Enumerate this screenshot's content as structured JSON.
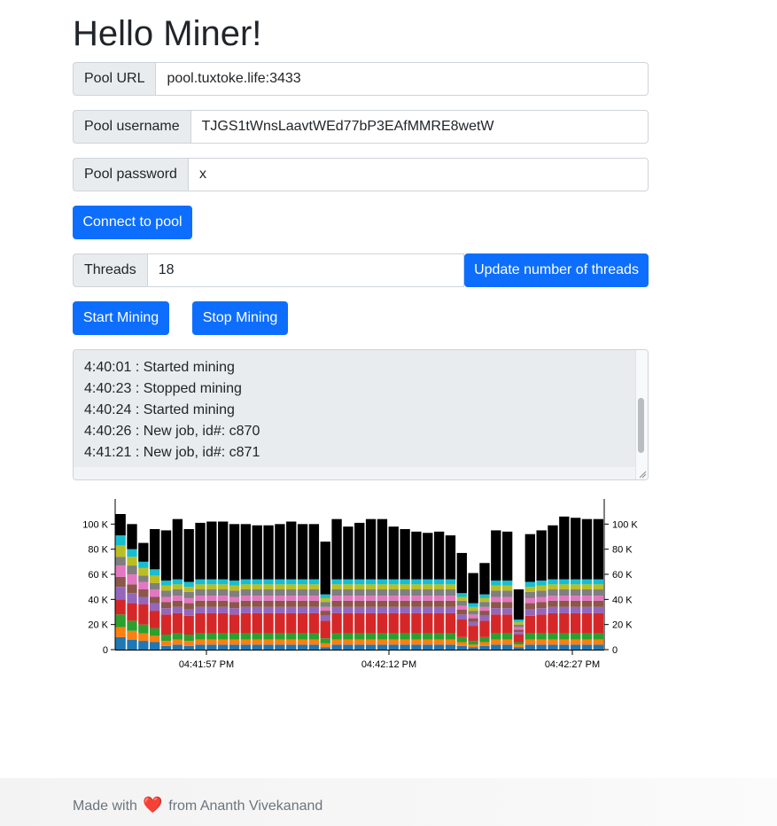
{
  "header": {
    "title": "Hello Miner!"
  },
  "pool": {
    "url_label": "Pool URL",
    "url_value": "pool.tuxtoke.life:3433",
    "username_label": "Pool username",
    "username_value": "TJGS1tWnsLaavtWEd77bP3EAfMMRE8wetW",
    "password_label": "Pool password",
    "password_value": "x",
    "connect_label": "Connect to pool"
  },
  "threads": {
    "label": "Threads",
    "value": "18",
    "update_label": "Update number of threads"
  },
  "mining": {
    "start_label": "Start Mining",
    "stop_label": "Stop Mining"
  },
  "log": {
    "lines": [
      "4:40:01 : Started mining",
      "4:40:23 : Stopped mining",
      "4:40:24 : Started mining",
      "4:40:26 : New job, id#: c870",
      "4:41:21 : New job, id#: c871"
    ]
  },
  "chart_data": {
    "type": "bar",
    "stacked": true,
    "y_ticks": [
      "0",
      "20 K",
      "40 K",
      "60 K",
      "80 K",
      "100 K"
    ],
    "ylim": [
      0,
      120000
    ],
    "x_ticks": [
      "04:41:57 PM",
      "04:42:12 PM",
      "04:42:27 PM"
    ],
    "series_colors": [
      "#1f77b4",
      "#ff7f0e",
      "#2ca02c",
      "#d62728",
      "#9467bd",
      "#8c564b",
      "#e377c2",
      "#7f7f7f",
      "#bcbd22",
      "#17becf",
      "#000000"
    ],
    "bars": [
      [
        10000,
        8000,
        10000,
        12000,
        10000,
        8000,
        9000,
        7000,
        9000,
        8000,
        17000
      ],
      [
        8000,
        7000,
        8000,
        14000,
        8000,
        7000,
        8000,
        7000,
        7000,
        6000,
        20000
      ],
      [
        7000,
        6000,
        7000,
        16000,
        6000,
        6000,
        6000,
        5000,
        6000,
        5000,
        15000
      ],
      [
        6000,
        5000,
        6000,
        14000,
        6000,
        5000,
        6000,
        5000,
        6000,
        5000,
        32000
      ],
      [
        3000,
        4000,
        5000,
        16000,
        5000,
        5000,
        4000,
        5000,
        4000,
        4000,
        40000
      ],
      [
        4000,
        4000,
        5000,
        16000,
        5000,
        5000,
        4000,
        5000,
        4000,
        4000,
        48000
      ],
      [
        3000,
        4000,
        5000,
        15000,
        5000,
        5000,
        4000,
        5000,
        4000,
        4000,
        42000
      ],
      [
        4000,
        4000,
        5000,
        16000,
        5000,
        5000,
        4000,
        5000,
        4000,
        4000,
        45000
      ],
      [
        4000,
        4000,
        5000,
        16000,
        5000,
        5000,
        4000,
        5000,
        4000,
        4000,
        46000
      ],
      [
        4000,
        4000,
        5000,
        16000,
        5000,
        5000,
        4000,
        5000,
        4000,
        4000,
        46000
      ],
      [
        4000,
        4000,
        5000,
        15000,
        5000,
        5000,
        4000,
        5000,
        4000,
        4000,
        45000
      ],
      [
        4000,
        4000,
        5000,
        16000,
        5000,
        5000,
        4000,
        5000,
        4000,
        4000,
        44000
      ],
      [
        4000,
        4000,
        5000,
        16000,
        5000,
        5000,
        4000,
        5000,
        4000,
        4000,
        43000
      ],
      [
        4000,
        4000,
        5000,
        16000,
        5000,
        5000,
        4000,
        5000,
        4000,
        4000,
        43000
      ],
      [
        4000,
        4000,
        5000,
        16000,
        5000,
        5000,
        4000,
        5000,
        4000,
        4000,
        44000
      ],
      [
        4000,
        4000,
        5000,
        16000,
        5000,
        5000,
        4000,
        5000,
        4000,
        4000,
        46000
      ],
      [
        4000,
        4000,
        5000,
        16000,
        5000,
        5000,
        4000,
        5000,
        4000,
        4000,
        44000
      ],
      [
        4000,
        4000,
        5000,
        16000,
        5000,
        5000,
        4000,
        5000,
        4000,
        4000,
        44000
      ],
      [
        2000,
        3000,
        4000,
        14000,
        4000,
        4000,
        3000,
        4000,
        3000,
        3000,
        42000
      ],
      [
        4000,
        4000,
        5000,
        16000,
        5000,
        5000,
        4000,
        5000,
        4000,
        4000,
        48000
      ],
      [
        4000,
        4000,
        5000,
        16000,
        5000,
        5000,
        4000,
        5000,
        4000,
        4000,
        42000
      ],
      [
        4000,
        4000,
        5000,
        16000,
        5000,
        5000,
        4000,
        5000,
        4000,
        4000,
        45000
      ],
      [
        4000,
        4000,
        5000,
        16000,
        5000,
        5000,
        4000,
        5000,
        4000,
        4000,
        48000
      ],
      [
        4000,
        4000,
        5000,
        16000,
        5000,
        5000,
        4000,
        5000,
        4000,
        4000,
        48000
      ],
      [
        4000,
        4000,
        5000,
        16000,
        5000,
        5000,
        4000,
        5000,
        4000,
        4000,
        42000
      ],
      [
        4000,
        4000,
        5000,
        16000,
        5000,
        5000,
        4000,
        5000,
        4000,
        4000,
        40000
      ],
      [
        4000,
        4000,
        5000,
        16000,
        5000,
        5000,
        4000,
        5000,
        4000,
        4000,
        38000
      ],
      [
        4000,
        4000,
        5000,
        16000,
        5000,
        5000,
        4000,
        5000,
        4000,
        4000,
        37000
      ],
      [
        4000,
        4000,
        5000,
        16000,
        5000,
        5000,
        4000,
        5000,
        4000,
        4000,
        38000
      ],
      [
        4000,
        4000,
        5000,
        16000,
        5000,
        5000,
        4000,
        5000,
        4000,
        4000,
        35000
      ],
      [
        3000,
        3000,
        4000,
        14000,
        4000,
        4000,
        3000,
        4000,
        3000,
        3000,
        32000
      ],
      [
        2000,
        2000,
        3000,
        12000,
        3000,
        3000,
        3000,
        3000,
        3000,
        3000,
        24000
      ],
      [
        3000,
        3000,
        4000,
        13000,
        4000,
        4000,
        3000,
        4000,
        3000,
        3000,
        25000
      ],
      [
        4000,
        4000,
        5000,
        15000,
        5000,
        5000,
        4000,
        5000,
        4000,
        4000,
        40000
      ],
      [
        4000,
        4000,
        5000,
        15000,
        5000,
        5000,
        4000,
        5000,
        4000,
        4000,
        39000
      ],
      [
        2000,
        2000,
        2000,
        6000,
        2000,
        2000,
        2000,
        2000,
        2000,
        2000,
        24000
      ],
      [
        4000,
        4000,
        5000,
        14000,
        5000,
        5000,
        4000,
        5000,
        4000,
        4000,
        38000
      ],
      [
        4000,
        4000,
        5000,
        15000,
        5000,
        5000,
        4000,
        5000,
        4000,
        4000,
        40000
      ],
      [
        4000,
        4000,
        5000,
        16000,
        5000,
        5000,
        4000,
        5000,
        4000,
        4000,
        43000
      ],
      [
        4000,
        4000,
        5000,
        16000,
        5000,
        5000,
        4000,
        5000,
        4000,
        4000,
        50000
      ],
      [
        4000,
        4000,
        5000,
        16000,
        5000,
        5000,
        4000,
        5000,
        4000,
        4000,
        49000
      ],
      [
        4000,
        4000,
        5000,
        16000,
        5000,
        5000,
        4000,
        5000,
        4000,
        4000,
        48000
      ],
      [
        4000,
        4000,
        5000,
        16000,
        5000,
        5000,
        4000,
        5000,
        4000,
        4000,
        48000
      ]
    ]
  },
  "footer": {
    "prefix": "Made with",
    "heart": "❤️",
    "suffix": "from Ananth Vivekanand"
  }
}
